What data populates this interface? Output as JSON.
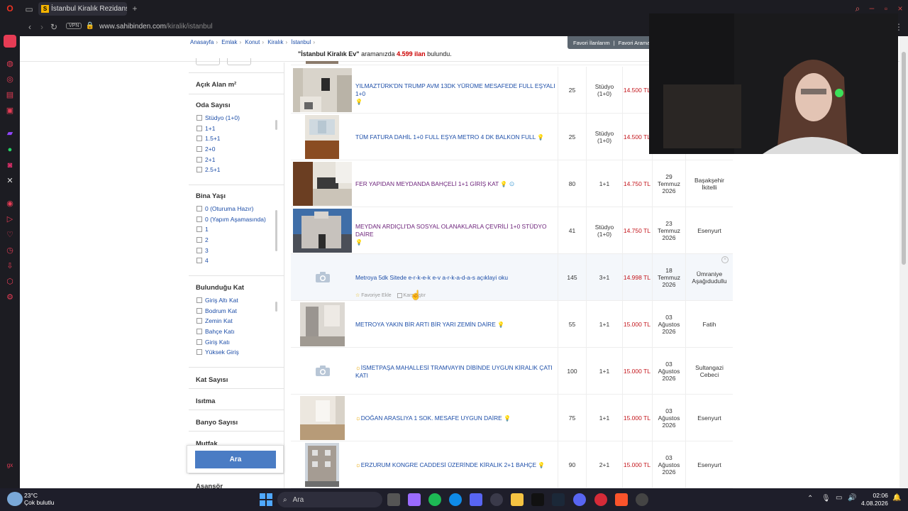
{
  "browser": {
    "tab_title": "İstanbul Kiralık Rezidans, V",
    "favicon_letter": "S",
    "url_host": "www.sahibinden.com",
    "url_path": "/kiralik/istanbul",
    "vpn_label": "VPN"
  },
  "breadcrumb": [
    "Anasayfa",
    "Emlak",
    "Konut",
    "Kiralık",
    "İstanbul"
  ],
  "favorites": {
    "favori_ilanlarim": "Favori İlanlarım",
    "separator": "|",
    "favori_aramalar": "Favori Aramala"
  },
  "summary": {
    "query": "\"İstanbul Kiralık Ev\"",
    "middle": "aramanızda",
    "count": "4.599 ilan",
    "suffix": "bulundu."
  },
  "filters": {
    "acik_alan": "Açık Alan m²",
    "oda_sayisi": {
      "title": "Oda Sayısı",
      "options": [
        "Stüdyo (1+0)",
        "1+1",
        "1.5+1",
        "2+0",
        "2+1",
        "2.5+1"
      ]
    },
    "bina_yasi": {
      "title": "Bina Yaşı",
      "options": [
        "0 (Oturuma Hazır)",
        "0 (Yapım Aşamasında)",
        "1",
        "2",
        "3",
        "4"
      ]
    },
    "bulundugu_kat": {
      "title": "Bulunduğu Kat",
      "options": [
        "Giriş Altı Kat",
        "Bodrum Kat",
        "Zemin Kat",
        "Bahçe Katı",
        "Giriş Katı",
        "Yüksek Giriş"
      ]
    },
    "kat_sayisi": "Kat Sayısı",
    "isitma": "Isıtma",
    "banyo_sayisi": "Banyo Sayısı",
    "mutfak": "Mutfak",
    "asansor": "Asansör",
    "ara_button": "Ara"
  },
  "listings": [
    {
      "title": "YILMAZTÜRK'DN TRUMP AVM 13DK YÜRÜME MESAFEDE FULL EŞYALI 1+0",
      "bulb": "💡",
      "m2": "25",
      "room_a": "Stüdyo",
      "room_b": "(1+0)",
      "price": "14.500 TL",
      "date_a": "",
      "date_b": "",
      "date_c": "",
      "loc_a": "",
      "loc_b": ""
    },
    {
      "title": "TÜM FATURA DAHİL 1+0 FULL EŞYA METRO 4 DK BALKON FULL",
      "bulb": "💡",
      "m2": "25",
      "room_a": "Stüdyo",
      "room_b": "(1+0)",
      "price": "14.500 TL",
      "date_a": "",
      "date_b": "",
      "date_c": "",
      "loc_a": "",
      "loc_b": ""
    },
    {
      "title": "FER YAPIDAN MEYDANDA BAHÇELİ 1+1 GİRİŞ KAT",
      "bulb": "💡",
      "m2": "80",
      "room_a": "1+1",
      "room_b": "",
      "price": "14.750 TL",
      "date_a": "29",
      "date_b": "Temmuz",
      "date_c": "2026",
      "loc_a": "Başakşehir",
      "loc_b": "İkitelli"
    },
    {
      "title": "MEYDAN ARDIÇLI'DA SOSYAL OLANAKLARLA ÇEVRİLİ 1+0 STÜDYO DAİRE",
      "bulb": "💡",
      "m2": "41",
      "room_a": "Stüdyo",
      "room_b": "(1+0)",
      "price": "14.750 TL",
      "date_a": "23",
      "date_b": "Temmuz",
      "date_c": "2026",
      "loc_a": "Esenyurt",
      "loc_b": ""
    },
    {
      "title": "Metroya 5dk Sitede e-r-k-e-k e-v a-r-k-a-d-a-s açıklayi oku",
      "bulb": "",
      "m2": "145",
      "room_a": "3+1",
      "room_b": "",
      "price": "14.998 TL",
      "date_a": "18",
      "date_b": "Temmuz",
      "date_c": "2026",
      "loc_a": "Ümraniye",
      "loc_b": "Aşağıdudullu",
      "fav": "Favoriye Ekle",
      "compare": "Karşılaştır"
    },
    {
      "title": "METROYA YAKIN BİR ARTI BİR YARI ZEMİN DAİRE",
      "bulb": "💡",
      "m2": "55",
      "room_a": "1+1",
      "room_b": "",
      "price": "15.000 TL",
      "date_a": "03",
      "date_b": "Ağustos",
      "date_c": "2026",
      "loc_a": "Fatih",
      "loc_b": ""
    },
    {
      "title": "İSMETPAŞA MAHALLESİ TRAMVAYIN DİBİNDE UYGUN KİRALIK ÇATI KATI",
      "bulb": "",
      "m2": "100",
      "room_a": "1+1",
      "room_b": "",
      "price": "15.000 TL",
      "date_a": "03",
      "date_b": "Ağustos",
      "date_c": "2026",
      "loc_a": "Sultangazi",
      "loc_b": "Cebeci"
    },
    {
      "title": "DOĞAN ARASLIYA 1 SOK. MESAFE UYGUN DAİRE",
      "bulb": "💡",
      "m2": "75",
      "room_a": "1+1",
      "room_b": "",
      "price": "15.000 TL",
      "date_a": "03",
      "date_b": "Ağustos",
      "date_c": "2026",
      "loc_a": "Esenyurt",
      "loc_b": ""
    },
    {
      "title": "ERZURUM KONGRE CADDESİ ÜZERİNDE KİRALIK 2+1 BAHÇE",
      "bulb": "💡",
      "m2": "90",
      "room_a": "2+1",
      "room_b": "",
      "price": "15.000 TL",
      "date_a": "03",
      "date_b": "Ağustos",
      "date_c": "2026",
      "loc_a": "Esenyurt",
      "loc_b": ""
    }
  ],
  "taskbar": {
    "weather_temp": "23°C",
    "weather_desc": "Çok bulutlu",
    "search_label": "Ara",
    "time": "02:06",
    "date": "4.08.2026"
  },
  "colors": {
    "link": "#1d4ea8",
    "price": "#c4161c",
    "button": "#4a7cc4",
    "chrome": "#1c1c22"
  }
}
